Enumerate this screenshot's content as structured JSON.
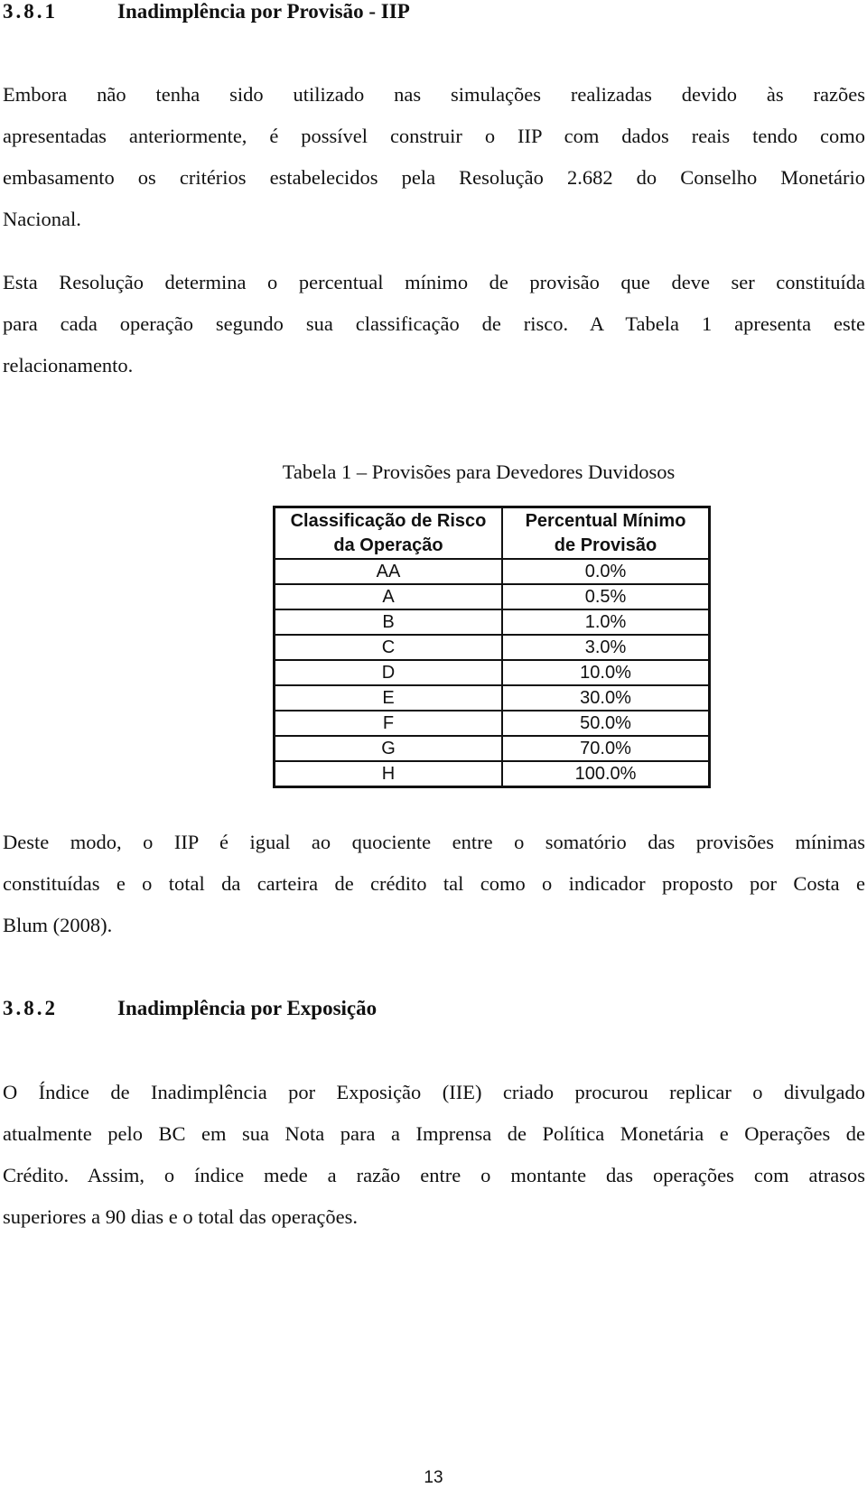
{
  "section1": {
    "number": "3.8.1",
    "title": "Inadimplência por Provisão - IIP",
    "paragraph1": [
      "Embora não tenha sido utilizado nas simulações realizadas devido às razões",
      "apresentadas anteriormente, é possível construir o IIP com dados reais tendo como",
      "embasamento os critérios estabelecidos pela Resolução 2.682 do Conselho Monetário",
      "Nacional."
    ],
    "paragraph2": [
      "Esta Resolução determina o percentual mínimo de provisão que deve ser constituída",
      "para cada operação segundo sua classificação de risco. A Tabela 1 apresenta este",
      "relacionamento."
    ]
  },
  "table": {
    "caption": "Tabela 1 – Provisões para Devedores Duvidosos",
    "headers": [
      "Classificação de Risco da Operação",
      "Percentual Mínimo de Provisão"
    ],
    "header_lines": [
      [
        "Classificação de Risco",
        "da Operação"
      ],
      [
        "Percentual Mínimo",
        "de Provisão"
      ]
    ],
    "rows": [
      [
        "AA",
        "0.0%"
      ],
      [
        "A",
        "0.5%"
      ],
      [
        "B",
        "1.0%"
      ],
      [
        "C",
        "3.0%"
      ],
      [
        "D",
        "10.0%"
      ],
      [
        "E",
        "30.0%"
      ],
      [
        "F",
        "50.0%"
      ],
      [
        "G",
        "70.0%"
      ],
      [
        "H",
        "100.0%"
      ]
    ]
  },
  "paragraph3": [
    "Deste modo, o IIP é igual ao quociente entre o somatório das provisões mínimas",
    "constituídas e o total da carteira de crédito tal como o indicador proposto por Costa e",
    "Blum (2008)."
  ],
  "section2": {
    "number": "3.8.2",
    "title": "Inadimplência por Exposição",
    "paragraph": [
      "O Índice de Inadimplência por Exposição (IIE) criado procurou replicar o divulgado",
      "atualmente pelo BC em sua Nota para a Imprensa de Política Monetária e Operações de",
      "Crédito. Assim, o índice mede a razão entre o montante das operações com atrasos",
      "superiores a 90 dias e o total das operações."
    ]
  },
  "page_number": "13"
}
